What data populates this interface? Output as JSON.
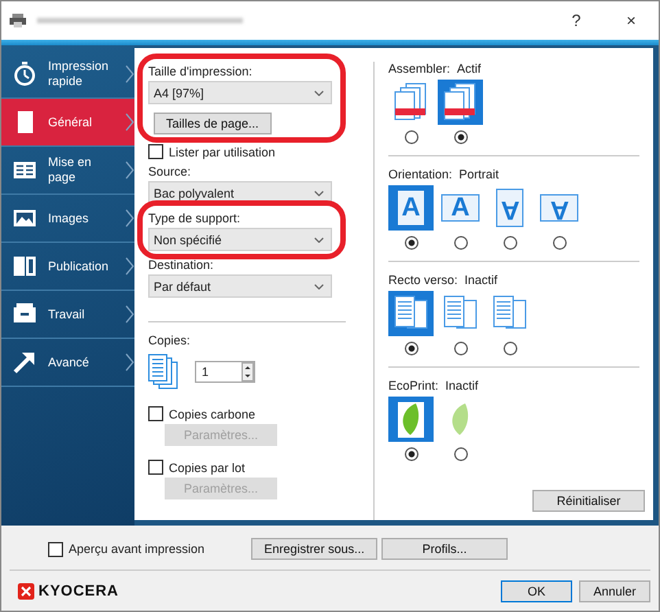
{
  "window": {
    "help": "?",
    "close": "×"
  },
  "sidebar": {
    "items": [
      {
        "label": "Impression rapide",
        "kind": "stopwatch",
        "selected": false
      },
      {
        "label": "Général",
        "kind": "page",
        "selected": true
      },
      {
        "label": "Mise en page",
        "kind": "layout",
        "selected": false
      },
      {
        "label": "Images",
        "kind": "picture",
        "selected": false
      },
      {
        "label": "Publication",
        "kind": "booklet",
        "selected": false
      },
      {
        "label": "Travail",
        "kind": "tray",
        "selected": false
      },
      {
        "label": "Avancé",
        "kind": "arrow",
        "selected": false
      }
    ]
  },
  "left_column": {
    "sections": [
      {
        "highlighted": true,
        "items": [
          {
            "kind": "select",
            "label": "Taille d'impression:",
            "value": "A4  [97%]"
          },
          {
            "kind": "button",
            "label": "Tailles de page...",
            "disabled": false
          }
        ]
      },
      {
        "highlighted": false,
        "items": [
          {
            "kind": "checkbox",
            "label": "Lister par utilisation",
            "checked": false
          },
          {
            "kind": "select",
            "label": "Source:",
            "value": "Bac polyvalent"
          }
        ]
      },
      {
        "highlighted": true,
        "items": [
          {
            "kind": "select",
            "label": "Type de support:",
            "value": "Non spécifié"
          }
        ]
      },
      {
        "highlighted": false,
        "items": [
          {
            "kind": "select",
            "label": "Destination:",
            "value": "Par défaut"
          }
        ]
      },
      {
        "highlighted": false,
        "divider": true,
        "items": [
          {
            "kind": "copies",
            "label": "Copies:",
            "value": "1"
          },
          {
            "kind": "checkbox",
            "label": "Copies carbone",
            "checked": false
          },
          {
            "kind": "button",
            "label": "Paramètres...",
            "disabled": true
          },
          {
            "kind": "checkbox",
            "label": "Copies par lot",
            "checked": false
          },
          {
            "kind": "button",
            "label": "Paramètres...",
            "disabled": true
          }
        ]
      }
    ]
  },
  "right_column": {
    "groups": [
      {
        "label": "Assembler:",
        "value": "Actif",
        "options": [
          {
            "kind": "uncollated",
            "selected": false
          },
          {
            "kind": "collated",
            "selected": true
          }
        ]
      },
      {
        "label": "Orientation:",
        "value": "Portrait",
        "options": [
          {
            "kind": "portrait",
            "glyph": "A",
            "selected": true
          },
          {
            "kind": "landscape",
            "glyph": "A",
            "selected": false
          },
          {
            "kind": "portrait-rotated",
            "glyph": "A",
            "selected": false
          },
          {
            "kind": "landscape-rotated",
            "glyph": "A",
            "selected": false
          }
        ]
      },
      {
        "label": "Recto verso:",
        "value": "Inactif",
        "options": [
          {
            "kind": "simplex",
            "selected": true
          },
          {
            "kind": "long-edge",
            "selected": false
          },
          {
            "kind": "short-edge",
            "selected": false
          }
        ]
      },
      {
        "label": "EcoPrint:",
        "value": "Inactif",
        "options": [
          {
            "kind": "leaf",
            "selected": true
          },
          {
            "kind": "leaf-pale",
            "selected": false
          }
        ]
      }
    ],
    "reset_button": "Réinitialiser"
  },
  "footer": {
    "preview": {
      "label": "Aperçu avant impression",
      "checked": false
    },
    "buttons": [
      "Enregistrer sous...",
      "Profils..."
    ],
    "logo": "KYOCERA",
    "ok": "OK",
    "cancel": "Annuler"
  }
}
